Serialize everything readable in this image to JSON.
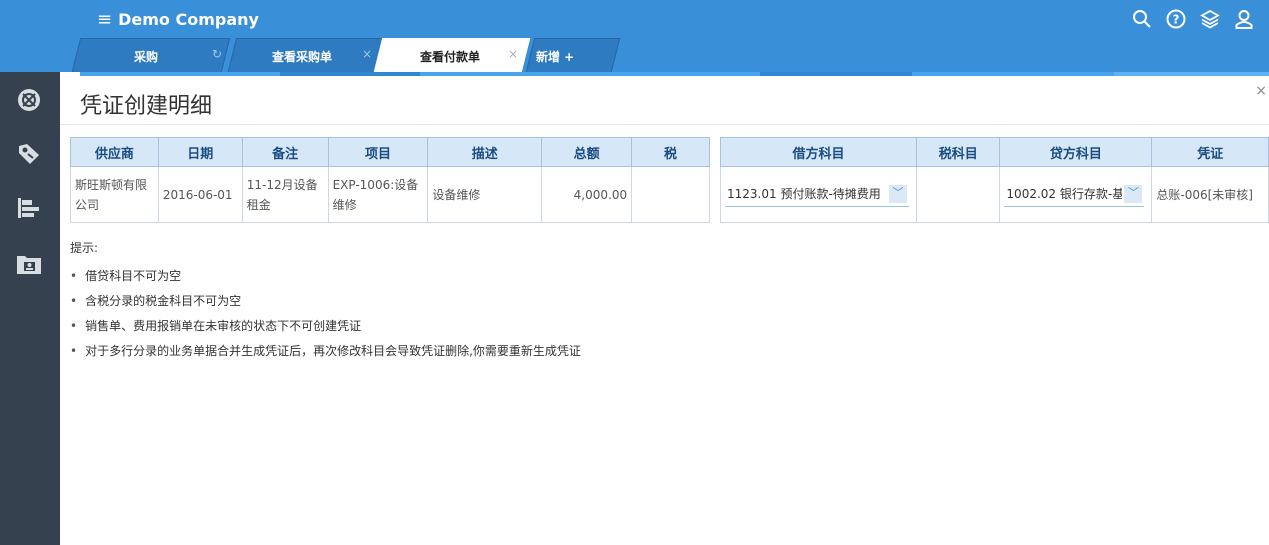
{
  "header": {
    "menu_glyph": "≡",
    "company": "Demo Company",
    "icons": [
      "search-icon",
      "help-icon",
      "layers-icon",
      "user-icon"
    ]
  },
  "tabs": [
    {
      "label": "采购",
      "close": "↻"
    },
    {
      "label": "查看采购单",
      "close": "×"
    },
    {
      "label": "查看付款单",
      "close": "×"
    },
    {
      "label": "新增 +",
      "close": ""
    }
  ],
  "sidebar": {
    "icons": [
      "settings-icon",
      "tag-icon",
      "report-icon",
      "folder-icon"
    ]
  },
  "page": {
    "title": "凭证创建明细",
    "close": "×"
  },
  "left_table": {
    "headers": [
      "供应商",
      "日期",
      "备注",
      "项目",
      "描述",
      "总额",
      "税"
    ],
    "row": {
      "supplier": "斯旺斯顿有限公司",
      "date": "2016-06-01",
      "remark": "11-12月设备租金",
      "project": "EXP-1006:设备维修",
      "description": "设备维修",
      "total": "4,000.00",
      "tax": ""
    }
  },
  "right_table": {
    "headers": [
      "借方科目",
      "税科目",
      "贷方科目",
      "凭证"
    ],
    "row": {
      "debit": "1123.01 预付账款-待摊费用",
      "tax_account": "",
      "credit": "1002.02 银行存款-基",
      "voucher": "总账-006[未审核]"
    }
  },
  "tips": {
    "title": "提示:",
    "items": [
      "借贷科目不可为空",
      "含税分录的税金科目不可为空",
      "销售单、费用报销单在未审核的状态下不可创建凭证",
      "对于多行分录的业务单据合并生成凭证后，再次修改科目会导致凭证删除,你需要重新生成凭证"
    ]
  },
  "colors": {
    "topbar": "#3a8fd9",
    "sidebar": "#35414e",
    "header_bg": "#d6e8f8",
    "accent": "#48a4ee"
  }
}
